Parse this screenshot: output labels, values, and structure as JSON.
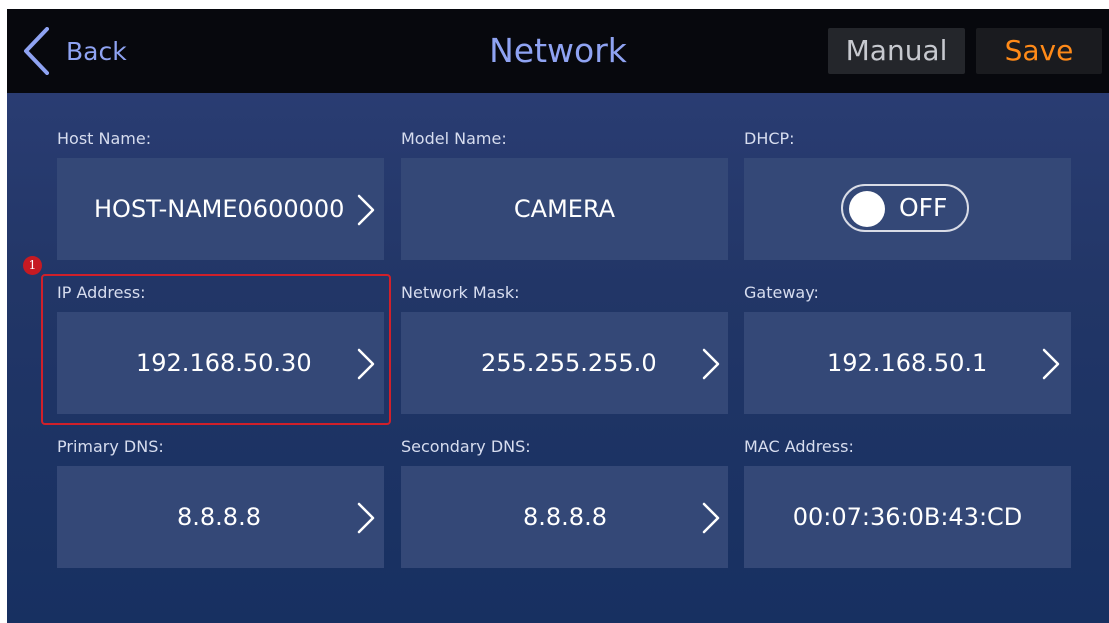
{
  "header": {
    "back_label": "Back",
    "title": "Network",
    "manual_label": "Manual",
    "save_label": "Save"
  },
  "fields": {
    "host_name": {
      "label": "Host Name:",
      "value": "HOST-NAME0600000"
    },
    "model_name": {
      "label": "Model Name:",
      "value": "CAMERA"
    },
    "dhcp": {
      "label": "DHCP:",
      "value": "OFF"
    },
    "ip_address": {
      "label": "IP Address:",
      "value": "192.168.50.30"
    },
    "network_mask": {
      "label": "Network Mask:",
      "value": "255.255.255.0"
    },
    "gateway": {
      "label": "Gateway:",
      "value": "192.168.50.1"
    },
    "primary_dns": {
      "label": "Primary DNS:",
      "value": "8.8.8.8"
    },
    "secondary_dns": {
      "label": "Secondary DNS:",
      "value": "8.8.8.8"
    },
    "mac_address": {
      "label": "MAC Address:",
      "value": "00:07:36:0B:43:CD"
    }
  },
  "annotation": {
    "badge_number": "1"
  },
  "colors": {
    "accent_blue": "#8fa3f2",
    "save_orange": "#ff8a18",
    "highlight_red": "#d0202a",
    "tile_bg": "#344877"
  }
}
